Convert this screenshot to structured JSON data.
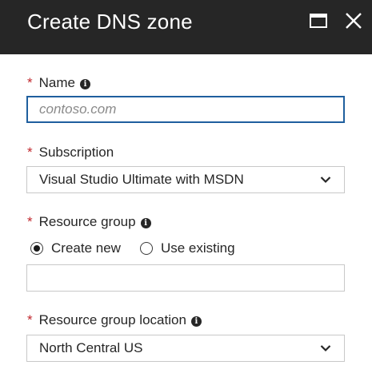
{
  "header": {
    "title": "Create DNS zone"
  },
  "fields": {
    "name": {
      "required_mark": "*",
      "label": "Name",
      "placeholder": "contoso.com",
      "value": ""
    },
    "subscription": {
      "required_mark": "*",
      "label": "Subscription",
      "selected": "Visual Studio Ultimate with MSDN"
    },
    "resource_group": {
      "required_mark": "*",
      "label": "Resource group",
      "options": [
        {
          "label": "Create new",
          "checked": true
        },
        {
          "label": "Use existing",
          "checked": false
        }
      ],
      "value": ""
    },
    "location": {
      "required_mark": "*",
      "label": "Resource group location",
      "selected": "North Central US"
    }
  },
  "colors": {
    "header_bg": "#262626",
    "required": "#c1272d",
    "focus_border": "#1f5f9e"
  },
  "icons": {
    "info": "info-icon",
    "maximize": "maximize-icon",
    "close": "close-icon",
    "dropdown": "chevron-down-icon"
  }
}
